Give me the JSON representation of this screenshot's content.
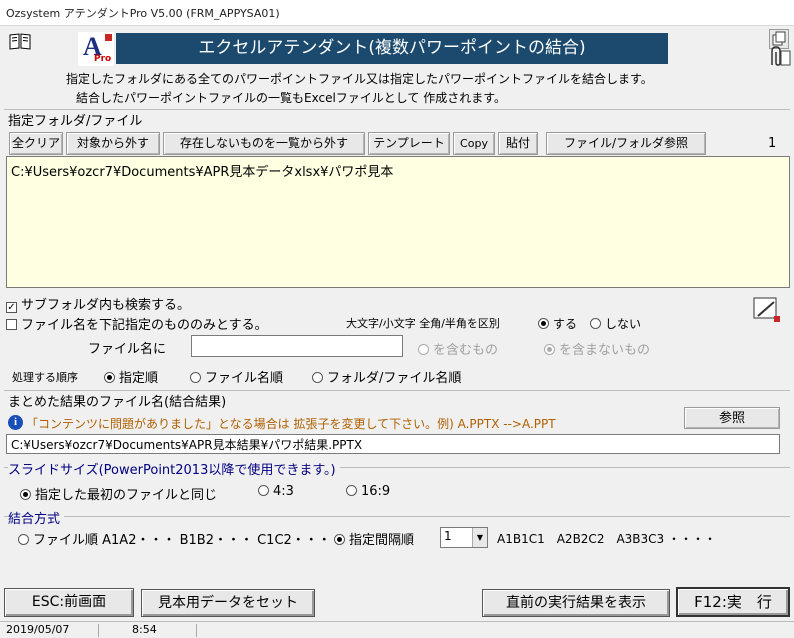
{
  "window": {
    "title": "Ozsystem アテンダントPro V5.00 (FRM_APPYSA01)"
  },
  "header": {
    "logo_letter": "A",
    "logo_sub": "Pro",
    "banner": "エクセルアテンダント(複数パワーポイントの結合)",
    "desc_line1": "指定したフォルダにある全てのパワーポイントファイル又は指定したパワーポイントファイルを結合します。",
    "desc_line2": "結合したパワーポイントファイルの一覧もExcelファイルとして 作成されます。"
  },
  "folder_section": {
    "title": "指定フォルダ/ファイル",
    "buttons": [
      "全クリア",
      "対象から外す",
      "存在しないものを一覧から外す",
      "テンプレート",
      "Copy",
      "貼付",
      "ファイル/フォルダ参照"
    ],
    "count": "1",
    "paths": [
      "C:¥Users¥ozcr7¥Documents¥APR見本データxlsx¥パワポ見本"
    ]
  },
  "options": {
    "subfolder_label": "サブフォルダ内も検索する。",
    "subfolder_checked": true,
    "filename_only_label": "ファイル名を下記指定のもののみとする。",
    "filename_only_checked": false,
    "case_label": "大文字/小文字 全角/半角を区別",
    "case_yes": "する",
    "case_no": "しない",
    "filename_label": "ファイル名に",
    "filename_value": "",
    "include_label": "を含むもの",
    "exclude_label": "を含まないもの",
    "order_label": "処理する順序",
    "order_specified": "指定順",
    "order_filename": "ファイル名順",
    "order_folder": "フォルダ/ファイル名順"
  },
  "result_section": {
    "title": "まとめた結果のファイル名(結合結果)",
    "note": "「コンテンツに問題がありました」となる場合は 拡張子を変更して下さい。例) A.PPTX -->A.PPT",
    "browse_button": "参照",
    "path": "C:¥Users¥ozcr7¥Documents¥APR見本結果¥パワポ結果.PPTX"
  },
  "slide_section": {
    "title": "スライドサイズ(PowerPoint2013以降で使用できます。)",
    "opt_first": "指定した最初のファイルと同じ",
    "opt_43": "4:3",
    "opt_169": "16:9"
  },
  "join_section": {
    "title": "結合方式",
    "opt_file_order": "ファイル順 A1A2・・・ B1B2・・・ C1C2・・・",
    "opt_interval": "指定間隔順",
    "interval_value": "1",
    "interval_example": "A1B1C1　A2B2C2　A3B3C3 ・・・・"
  },
  "footer": {
    "esc_button": "ESC:前画面",
    "sample_button": "見本用データをセット",
    "last_result_button": "直前の実行結果を表示",
    "run_button": "F12:実　行"
  },
  "statusbar": {
    "date": "2019/05/07",
    "time": "8:54"
  },
  "colors": {
    "banner_bg": "#1b4a6e",
    "list_bg": "#ffffe1",
    "note_text": "#b06000",
    "info_icon": "#1a4fb8"
  }
}
